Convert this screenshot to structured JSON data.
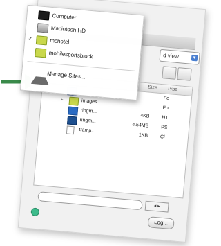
{
  "popup_menu": {
    "items": [
      {
        "label": "Computer",
        "icon": "monitor-icon",
        "checked": false
      },
      {
        "label": "Macintosh HD",
        "icon": "hard-drive-icon",
        "checked": false
      },
      {
        "label": "mchotel",
        "icon": "folder-icon",
        "checked": true
      },
      {
        "label": "mobilesportsblock",
        "icon": "folder-icon",
        "checked": false
      },
      {
        "label": "Manage Sites...",
        "icon": "sites-icon",
        "checked": false
      }
    ],
    "check_glyph": "✓"
  },
  "panel": {
    "view_select": "d view",
    "columns": {
      "size": "Size",
      "type": "Type"
    },
    "rows": [
      {
        "name": "",
        "size": "",
        "type": "Fo",
        "icon": "folder-icon"
      },
      {
        "name": "images",
        "size": "",
        "type": "Fo",
        "icon": "folder-icon"
      },
      {
        "name": "ringm...",
        "size": "4KB",
        "type": "HT",
        "icon": "document-icon"
      },
      {
        "name": "ringm...",
        "size": "4.54MB",
        "type": "PS",
        "icon": "photoshop-file-icon"
      },
      {
        "name": "tramp...",
        "size": "1KB",
        "type": "Cl",
        "icon": "document-icon"
      }
    ]
  },
  "footer": {
    "log_label": "Log...",
    "scroll_arrows": "◂ ▸"
  },
  "colors": {
    "arrow": "#3a8a4a",
    "folder": "#c9d84c",
    "status_dot": "#3dbb8b"
  }
}
